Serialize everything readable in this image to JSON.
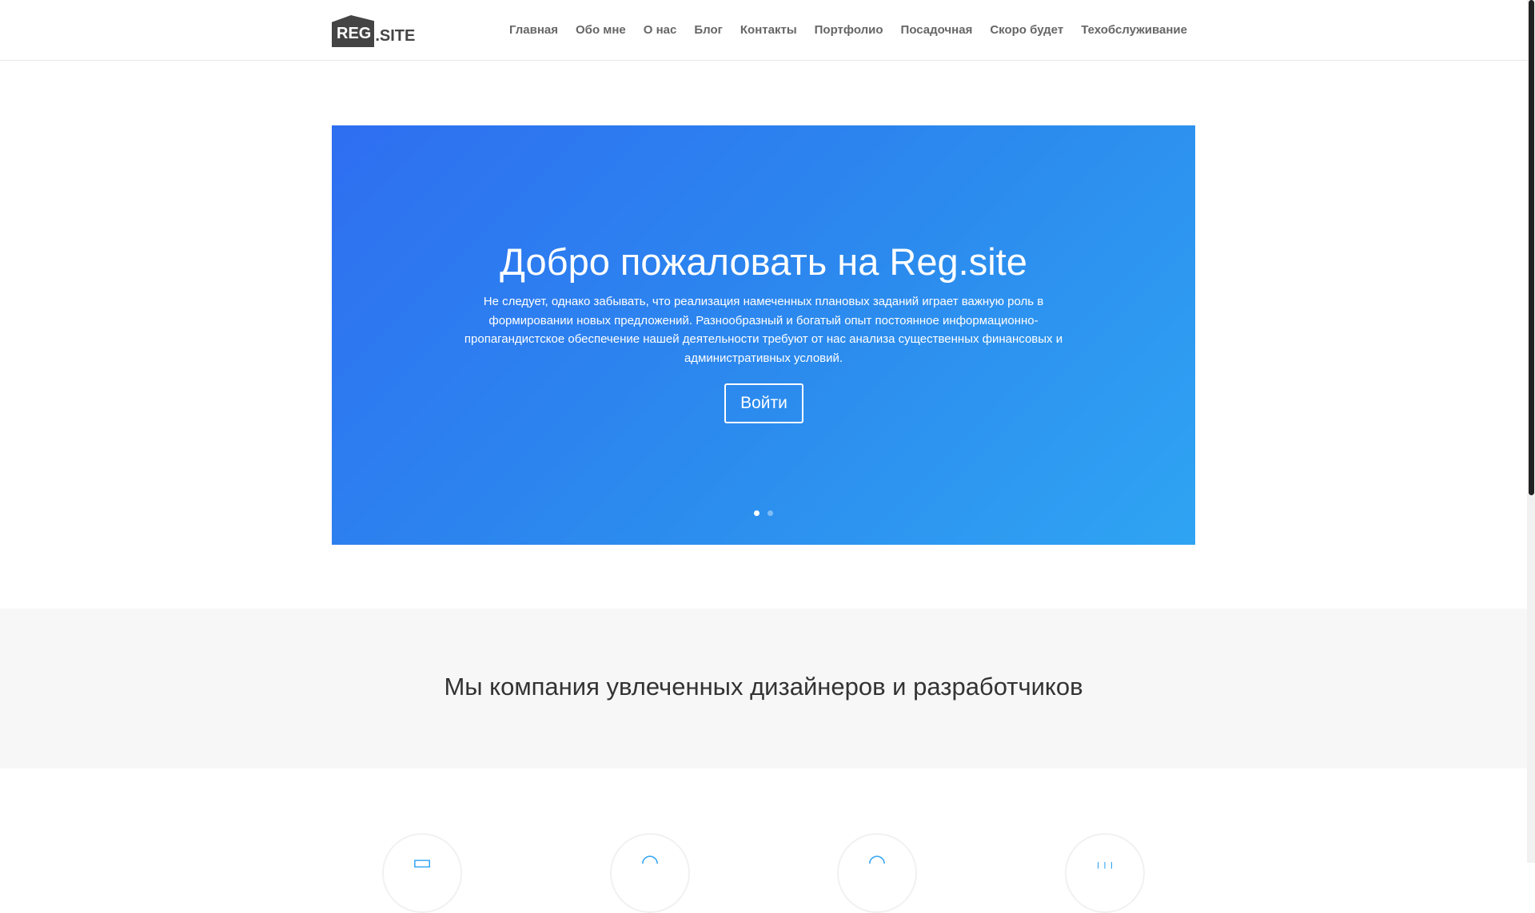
{
  "header": {
    "logo": "REG.SITE",
    "logo_parts": [
      "REG",
      ".SITE"
    ],
    "nav": [
      "Главная",
      "Обо мне",
      "О нас",
      "Блог",
      "Контакты",
      "Портфолио",
      "Посадочная",
      "Скоро будет",
      "Техобслуживание"
    ]
  },
  "hero": {
    "title": "Добро пожаловать на Reg.site",
    "text": "Не следует, однако забывать, что реализация намеченных плановых заданий играет важную роль в формировании новых предложений. Разнообразный и богатый опыт постоянное информационно-пропагандистское обеспечение нашей деятельности требуют от нас анализа существенных финансовых и административных условий.",
    "button": "Войти",
    "slides": 2,
    "active_slide": 1
  },
  "intro": {
    "heading": "Мы компания увлеченных дизайнеров и разработчиков"
  },
  "features": {
    "icons": [
      "tablet-icon",
      "location-icon",
      "speed-icon",
      "chart-icon"
    ]
  },
  "colors": {
    "accent": "#2ea3f2",
    "gradient_start": "#2e6ef1"
  }
}
